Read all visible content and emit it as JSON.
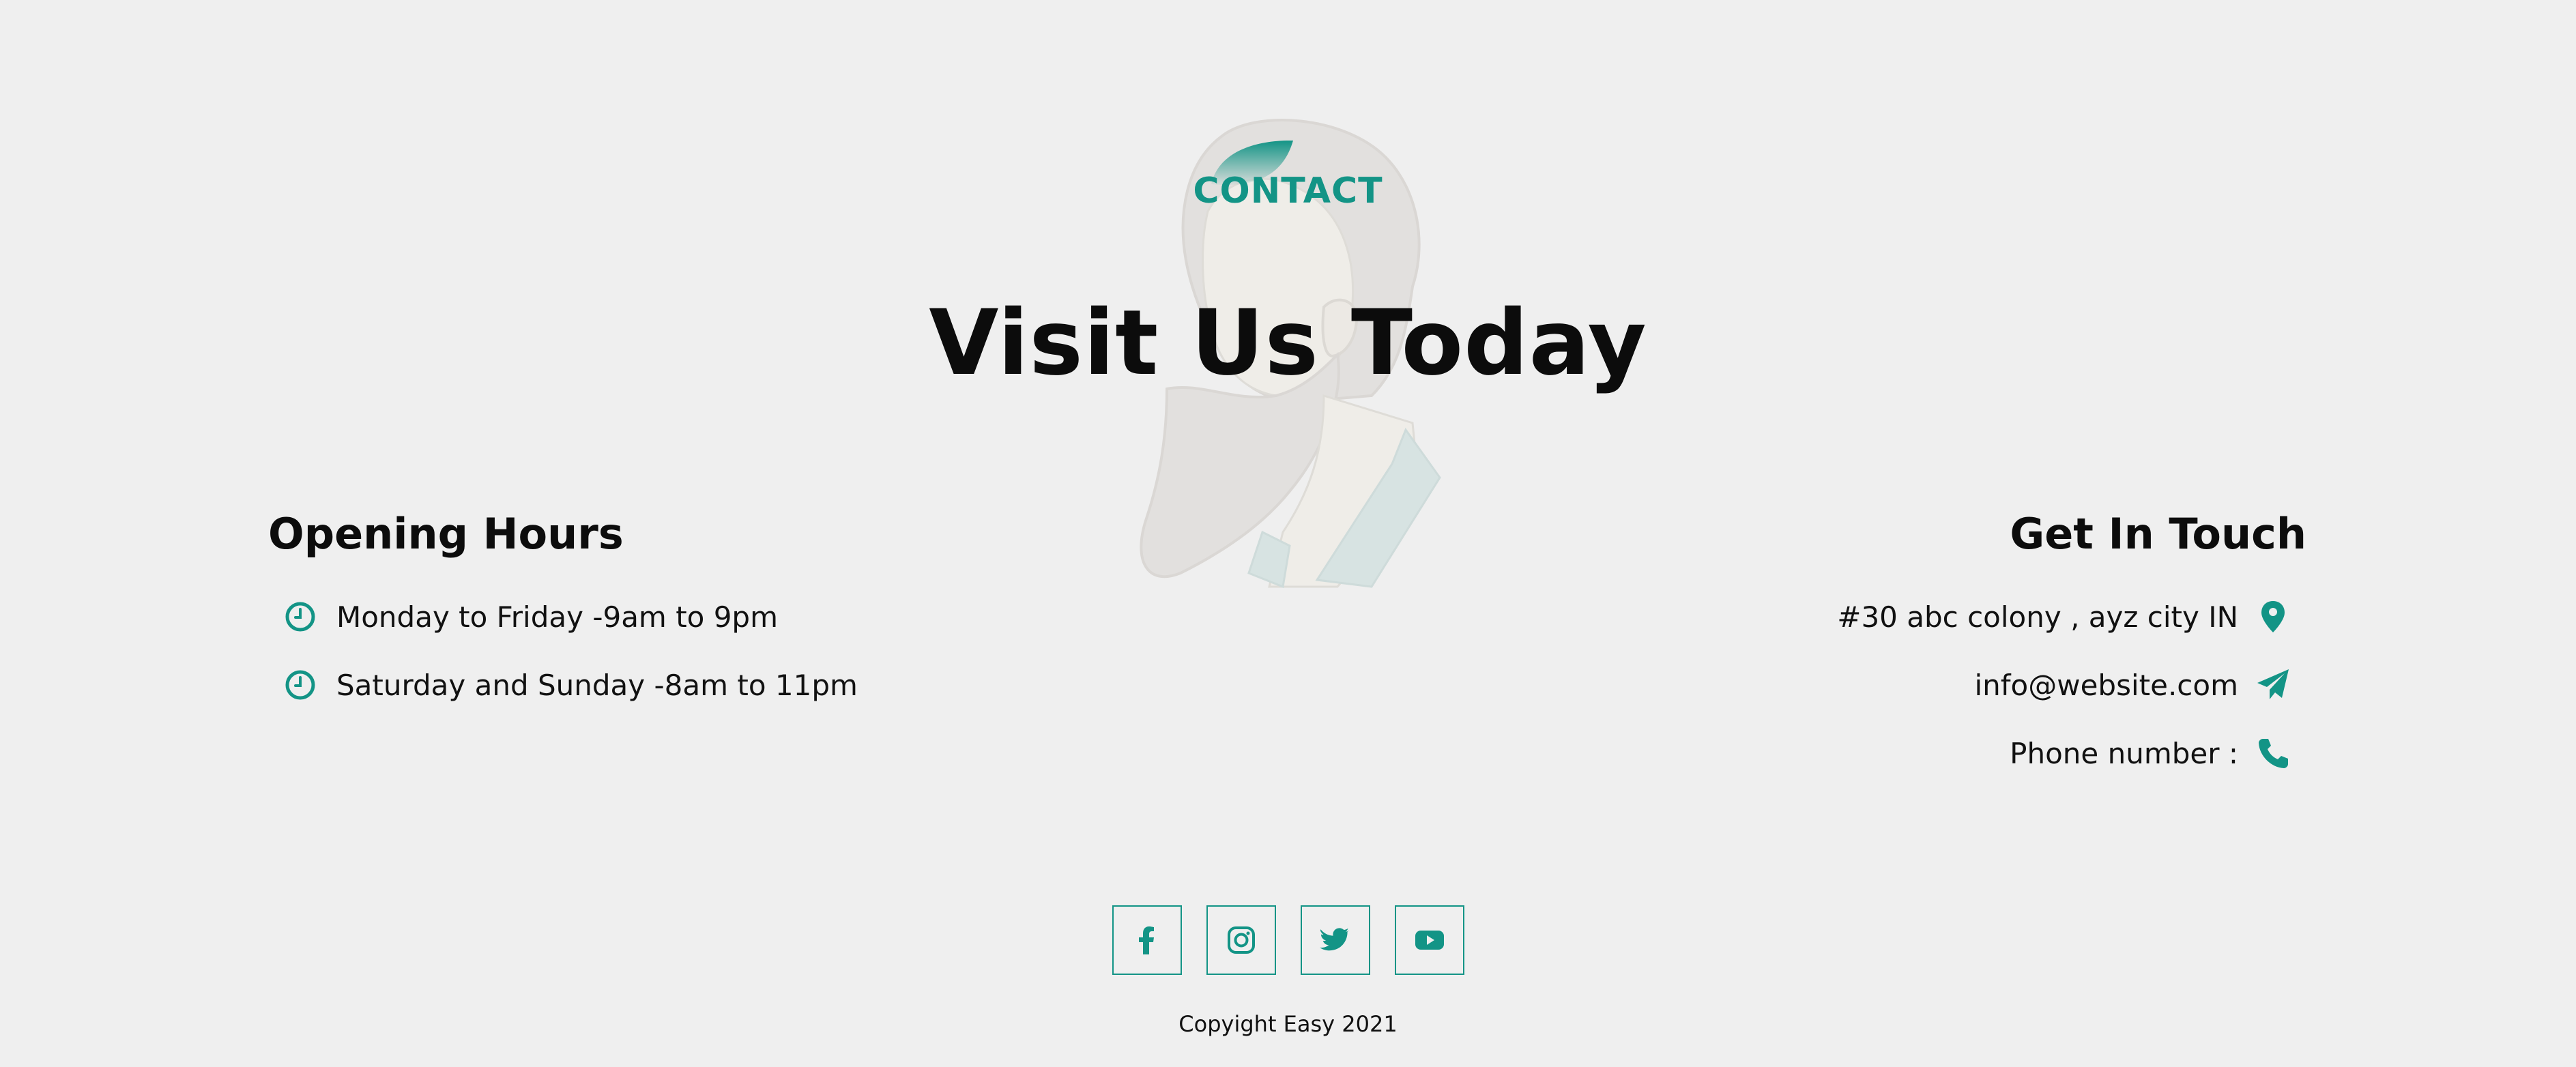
{
  "colors": {
    "accent": "#139486",
    "background": "#efefef",
    "text": "#111111"
  },
  "header": {
    "label": "CONTACT",
    "title": "Visit Us Today"
  },
  "hours": {
    "heading": "Opening Hours",
    "items": [
      {
        "icon": "clock-icon",
        "text": "Monday to Friday -9am to 9pm"
      },
      {
        "icon": "clock-icon",
        "text": "Saturday and Sunday -8am to 11pm"
      }
    ]
  },
  "touch": {
    "heading": "Get In Touch",
    "items": [
      {
        "icon": "map-pin-icon",
        "text": "#30 abc colony , ayz city IN"
      },
      {
        "icon": "paper-plane-icon",
        "text": "info@website.com"
      },
      {
        "icon": "phone-icon",
        "text": "Phone number :"
      }
    ]
  },
  "social": [
    {
      "icon": "facebook-icon"
    },
    {
      "icon": "instagram-icon"
    },
    {
      "icon": "twitter-icon"
    },
    {
      "icon": "youtube-icon"
    }
  ],
  "footer": {
    "copyright": "Copyight Easy 2021"
  }
}
